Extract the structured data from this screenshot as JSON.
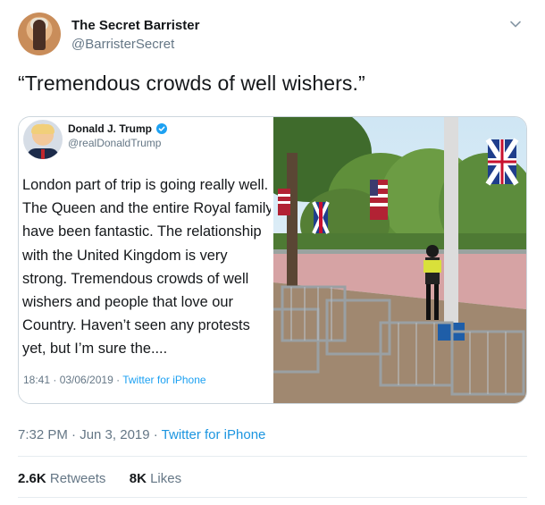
{
  "author": {
    "name": "The Secret Barrister",
    "handle": "@BarristerSecret"
  },
  "tweet_text": "“Tremendous crowds of well wishers.”",
  "quoted": {
    "name": "Donald J. Trump",
    "handle": "@realDonaldTrump",
    "lines": [
      "London part of trip is going really well.",
      "The Queen and the entire Royal family",
      "have been fantastic. The relationship",
      "with the United Kingdom is very",
      "strong. Tremendous crowds of well",
      "wishers and people that love our",
      "Country. Haven’t seen any protests",
      "yet, but I’m sure the...."
    ],
    "time": "18:41 · 03/06/2019 · ",
    "source": "Twitter for iPhone"
  },
  "meta": {
    "time": "7:32 PM · Jun 3, 2019 · ",
    "source": "Twitter for iPhone"
  },
  "stats": {
    "retweets_count": "2.6K",
    "retweets_label": "Retweets",
    "likes_count": "8K",
    "likes_label": "Likes"
  },
  "icons": {
    "menu": "chevron-down-icon",
    "verified": "verified-badge-icon"
  },
  "colors": {
    "link": "#1da1f2",
    "muted": "#657786",
    "border": "#ccd6dd"
  }
}
